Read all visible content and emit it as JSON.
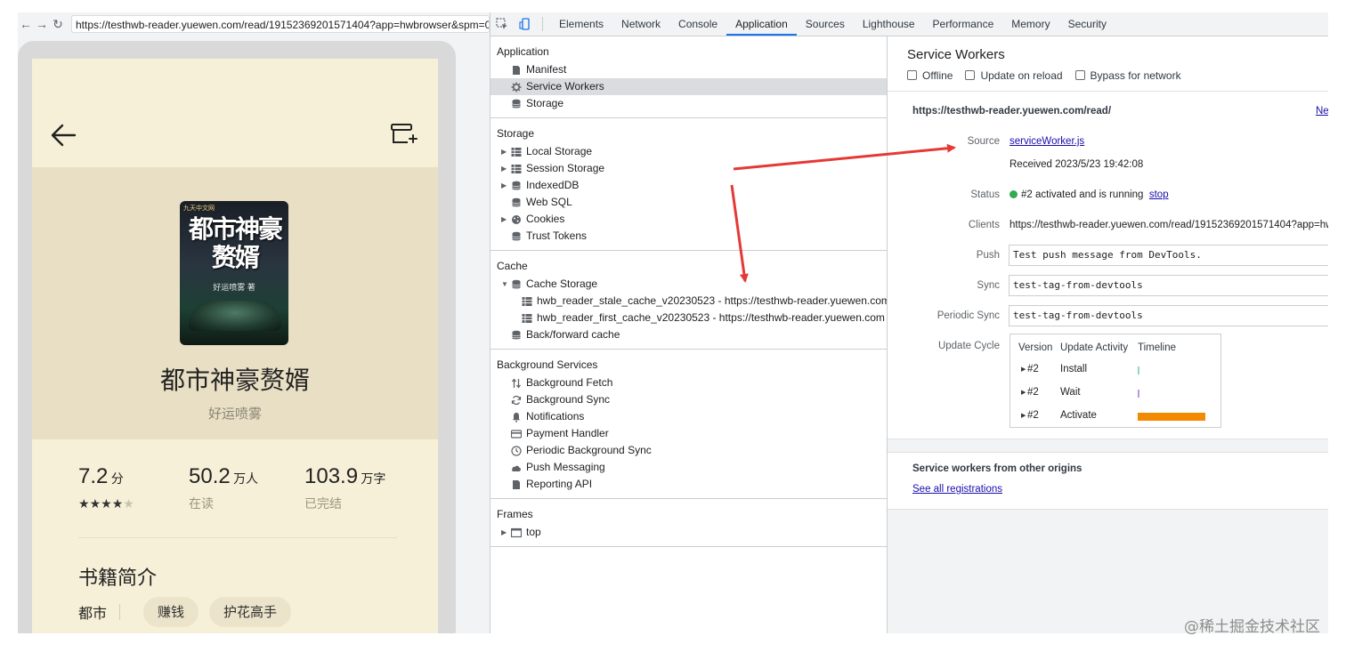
{
  "browser": {
    "url": "https://testhwb-reader.yuewen.com/read/19152369201571404?app=hwbrowser&spm=01-0"
  },
  "phone": {
    "cover": {
      "title": "都市神豪赘婿",
      "author": "好运喷雾 著",
      "brand": "九天中文网"
    },
    "book_title": "都市神豪赘婿",
    "book_author": "好运喷雾",
    "stats": {
      "rating": "7.2",
      "rating_unit": "分",
      "rating_stars": 3.5,
      "readers": "50.2",
      "readers_unit": "万人",
      "readers_label": "在读",
      "words": "103.9",
      "words_unit": "万字",
      "words_label": "已完结"
    },
    "intro_heading": "书籍简介",
    "category": "都市",
    "tags": [
      "赚钱",
      "护花高手"
    ]
  },
  "devtools": {
    "tabs": [
      "Elements",
      "Network",
      "Console",
      "Application",
      "Sources",
      "Lighthouse",
      "Performance",
      "Memory",
      "Security"
    ],
    "active_tab": "Application",
    "sidebar": {
      "application": {
        "title": "Application",
        "items": [
          {
            "label": "Manifest",
            "icon": "file-icon"
          },
          {
            "label": "Service Workers",
            "icon": "gear-icon",
            "selected": true
          },
          {
            "label": "Storage",
            "icon": "database-icon"
          }
        ]
      },
      "storage": {
        "title": "Storage",
        "items": [
          {
            "label": "Local Storage",
            "icon": "grid-icon",
            "expandable": true
          },
          {
            "label": "Session Storage",
            "icon": "grid-icon",
            "expandable": true
          },
          {
            "label": "IndexedDB",
            "icon": "database-icon",
            "expandable": true
          },
          {
            "label": "Web SQL",
            "icon": "database-icon"
          },
          {
            "label": "Cookies",
            "icon": "cookie-icon",
            "expandable": true
          },
          {
            "label": "Trust Tokens",
            "icon": "database-icon"
          }
        ]
      },
      "cache": {
        "title": "Cache",
        "items": [
          {
            "label": "Cache Storage",
            "icon": "database-icon",
            "expanded": true
          },
          {
            "label": "hwb_reader_stale_cache_v20230523 - https://testhwb-reader.yuewen.com",
            "icon": "grid-icon",
            "child": true
          },
          {
            "label": "hwb_reader_first_cache_v20230523 - https://testhwb-reader.yuewen.com",
            "icon": "grid-icon",
            "child": true
          },
          {
            "label": "Back/forward cache",
            "icon": "database-icon"
          }
        ]
      },
      "background_services": {
        "title": "Background Services",
        "items": [
          {
            "label": "Background Fetch",
            "icon": "arrows-updown-icon"
          },
          {
            "label": "Background Sync",
            "icon": "sync-icon"
          },
          {
            "label": "Notifications",
            "icon": "bell-icon"
          },
          {
            "label": "Payment Handler",
            "icon": "card-icon"
          },
          {
            "label": "Periodic Background Sync",
            "icon": "clock-icon"
          },
          {
            "label": "Push Messaging",
            "icon": "cloud-icon"
          },
          {
            "label": "Reporting API",
            "icon": "file-icon"
          }
        ]
      },
      "frames": {
        "title": "Frames",
        "items": [
          {
            "label": "top",
            "icon": "frame-icon",
            "expandable": true
          }
        ]
      }
    },
    "service_workers": {
      "title": "Service Workers",
      "options": [
        "Offline",
        "Update on reload",
        "Bypass for network"
      ],
      "scope": "https://testhwb-reader.yuewen.com/read/",
      "new_link": "Ne",
      "source_label": "Source",
      "source_file": "serviceWorker.js",
      "received": "Received 2023/5/23 19:42:08",
      "status_label": "Status",
      "status_text": "#2 activated and is running",
      "status_action": "stop",
      "clients_label": "Clients",
      "clients_value": "https://testhwb-reader.yuewen.com/read/19152369201571404?app=hw",
      "push_label": "Push",
      "push_value": "Test push message from DevTools.",
      "sync_label": "Sync",
      "sync_value": "test-tag-from-devtools",
      "periodic_sync_label": "Periodic Sync",
      "periodic_sync_value": "test-tag-from-devtools",
      "update_cycle_label": "Update Cycle",
      "update_cycle": {
        "headers": [
          "Version",
          "Update Activity",
          "Timeline"
        ],
        "rows": [
          {
            "version": "#2",
            "activity": "Install",
            "bar_color": "#9ad3c7",
            "bar_fraction": 0.02
          },
          {
            "version": "#2",
            "activity": "Wait",
            "bar_color": "#b39ddb",
            "bar_fraction": 0.02
          },
          {
            "version": "#2",
            "activity": "Activate",
            "bar_color": "#f28b00",
            "bar_fraction": 1.0
          }
        ]
      },
      "other_origins_title": "Service workers from other origins",
      "see_all": "See all registrations"
    }
  },
  "watermark": "@稀土掘金技术社区",
  "colors": {
    "annotation_arrow": "#e53935",
    "phone_bg": "#f7f0d8",
    "link": "#1a0dab",
    "active_tab_underline": "#1a73e8"
  }
}
